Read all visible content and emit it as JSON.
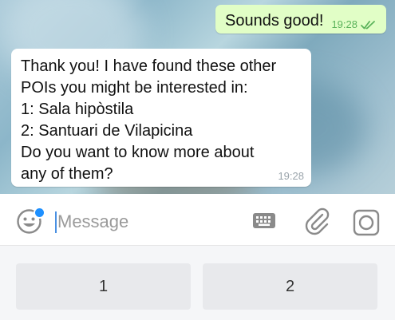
{
  "outgoing": {
    "text": "Sounds good!",
    "time": "19:28"
  },
  "incoming": {
    "lines": [
      "Thank you! I have found these other",
      "POIs you might be interested in:",
      "1: Sala hipòstila",
      "2: Santuari de Vilapicina",
      "Do you want to know more about",
      "any of them?"
    ],
    "time": "19:28"
  },
  "input": {
    "placeholder": "Message",
    "value": ""
  },
  "icons": {
    "emoji": "emoji-icon",
    "keyboard": "keyboard-icon",
    "attach": "paperclip-icon",
    "camera": "camera-icon",
    "read_status": "double-check-icon"
  },
  "keyboard_buttons": [
    "1",
    "2"
  ],
  "colors": {
    "outgoing_bubble": "#e1fec6",
    "incoming_bubble": "#ffffff",
    "time_out": "#5bb35b",
    "accent": "#1e90ff"
  }
}
